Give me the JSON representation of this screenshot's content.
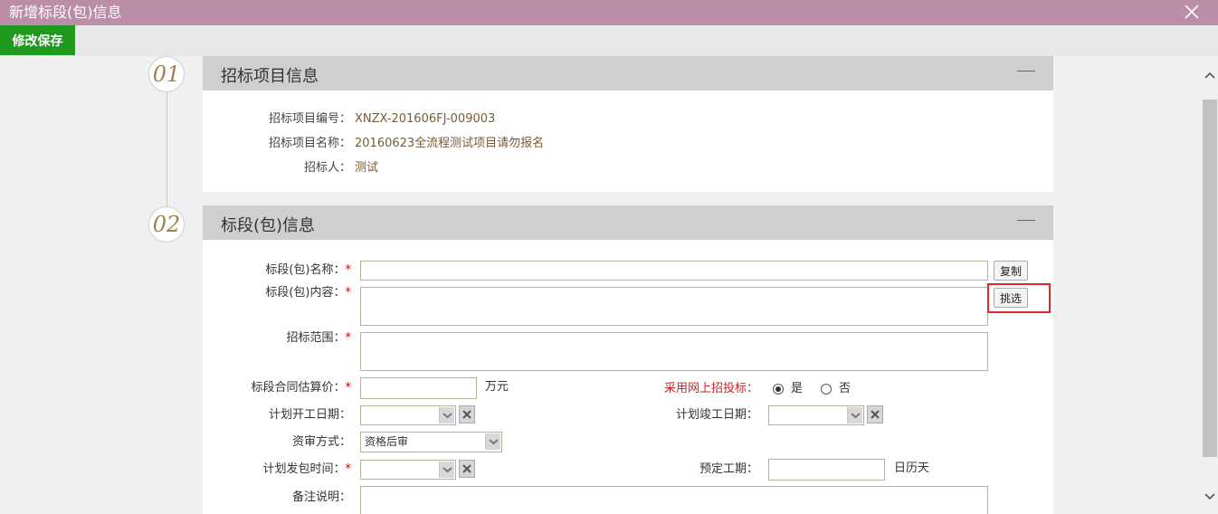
{
  "window": {
    "title": "新增标段(包)信息"
  },
  "toolbar": {
    "save_label": "修改保存"
  },
  "steps": [
    "01",
    "02"
  ],
  "section1": {
    "title": "招标项目信息",
    "fields": [
      {
        "label": "招标项目编号：",
        "value": "XNZX-201606FJ-009003"
      },
      {
        "label": "招标项目名称：",
        "value": "20160623全流程测试项目请勿报名"
      },
      {
        "label": "招标人：",
        "value": "测试"
      }
    ]
  },
  "section2": {
    "title": "标段(包)信息",
    "labels": {
      "name": "标段(包)名称：",
      "content": "标段(包)内容：",
      "scope": "招标范围：",
      "price": "标段合同估算价：",
      "online": "采用网上招投标：",
      "start_date": "计划开工日期：",
      "end_date": "计划竣工日期：",
      "review": "资审方式：",
      "publish_time": "计划发包时间：",
      "duration": "预定工期：",
      "remark": "备注说明："
    },
    "required_mark": "*",
    "buttons": {
      "copy": "复制",
      "select": "挑选"
    },
    "units": {
      "price": "万元",
      "duration": "日历天"
    },
    "radio": {
      "yes": "是",
      "no": "否",
      "selected": "是"
    },
    "review_value": "资格后审"
  },
  "colors": {
    "titlebar": "#bb8ea8",
    "save": "#1f9a1f",
    "highlight": "#e0282a"
  }
}
